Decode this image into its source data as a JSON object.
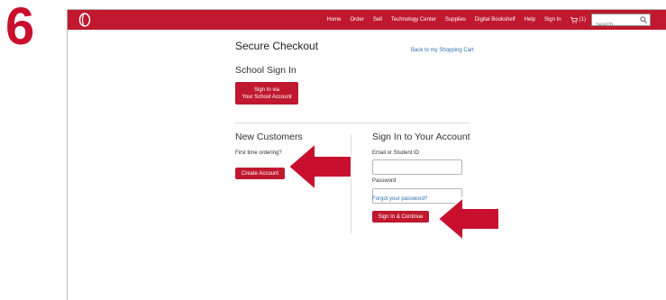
{
  "step_number": "6",
  "colors": {
    "brand": "#c0182e",
    "arrow": "#c8102e",
    "link": "#2f6fb0"
  },
  "logo_icon": "brand-logo-icon",
  "nav": {
    "items": [
      "Home",
      "Order",
      "Sell",
      "Technology Center",
      "Supplies",
      "Digital Bookshelf",
      "Help",
      "Sign In"
    ],
    "cart_label": "(1)",
    "cart_icon": "cart-icon",
    "search_placeholder": "Search",
    "search_icon": "search-icon"
  },
  "page": {
    "title": "Secure Checkout",
    "back_link": "Back to my Shopping Cart"
  },
  "school": {
    "title": "School Sign In",
    "button_line1": "Sign In via",
    "button_line2": "Your School Account"
  },
  "new_customers": {
    "title": "New Customers",
    "subtitle": "First time ordering?",
    "button": "Create Account"
  },
  "signin": {
    "title": "Sign In to Your Account",
    "email_label": "Email or Student ID",
    "email_value": "",
    "password_label": "Password",
    "password_value": "",
    "forgot_link": "Forgot your password?",
    "button": "Sign In & Continue"
  }
}
